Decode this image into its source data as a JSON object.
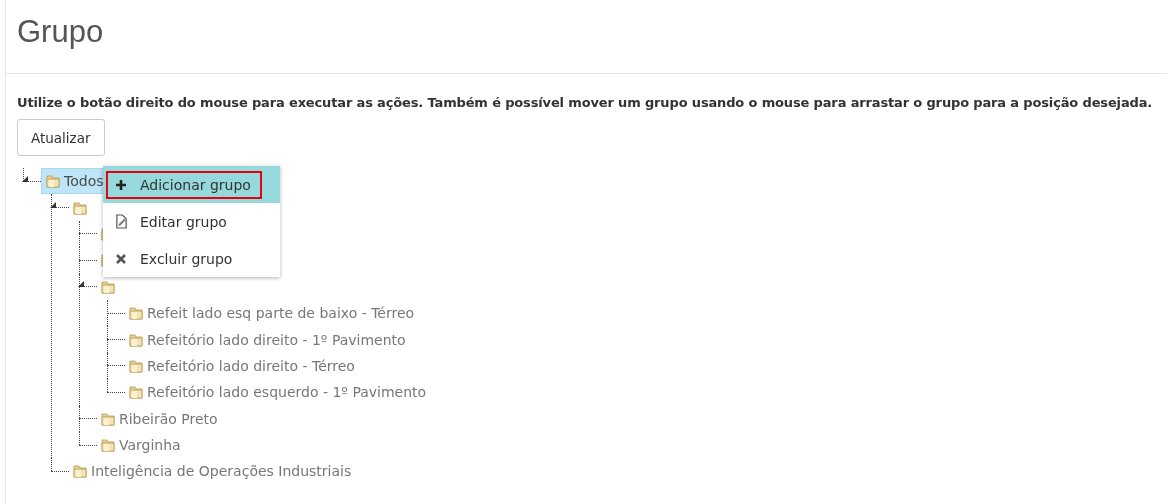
{
  "page": {
    "title": "Grupo",
    "instructions": "Utilize o botão direito do mouse para executar as ações. Também é possível mover um grupo usando o mouse para arrastar o grupo para a posição desejada."
  },
  "buttons": [
    {
      "label": "Atualizar"
    }
  ],
  "tree": [
    {
      "label": "Todos",
      "selected": true,
      "expanded": true,
      "children": [
        {
          "selected": false,
          "expanded": true,
          "children": [
            {
              "selected": false,
              "expanded": false
            },
            {
              "selected": false,
              "expanded": false
            },
            {
              "selected": false,
              "expanded": true,
              "children": [
                {
                  "label": "Refeit lado esq parte de baixo - Térreo",
                  "selected": false,
                  "expanded": false
                },
                {
                  "label": "Refeitório lado direito - 1º Pavimento",
                  "selected": false,
                  "expanded": false
                },
                {
                  "label": "Refeitório lado direito - Térreo",
                  "selected": false,
                  "expanded": false
                },
                {
                  "label": "Refeitório lado esquerdo - 1º Pavimento",
                  "selected": false,
                  "expanded": false
                }
              ]
            },
            {
              "label": "Ribeirão Preto",
              "selected": false,
              "expanded": false
            },
            {
              "label": "Varginha",
              "selected": false,
              "expanded": false
            }
          ]
        },
        {
          "label": "Inteligência de Operações Industriais",
          "selected": false,
          "expanded": false
        }
      ]
    }
  ],
  "context_menu": {
    "items": [
      {
        "label": "Adicionar grupo",
        "kind": "add",
        "selected": true
      },
      {
        "label": "Editar grupo",
        "kind": "edit",
        "selected": false
      },
      {
        "label": "Excluir grupo",
        "kind": "delete",
        "selected": false
      }
    ]
  }
}
